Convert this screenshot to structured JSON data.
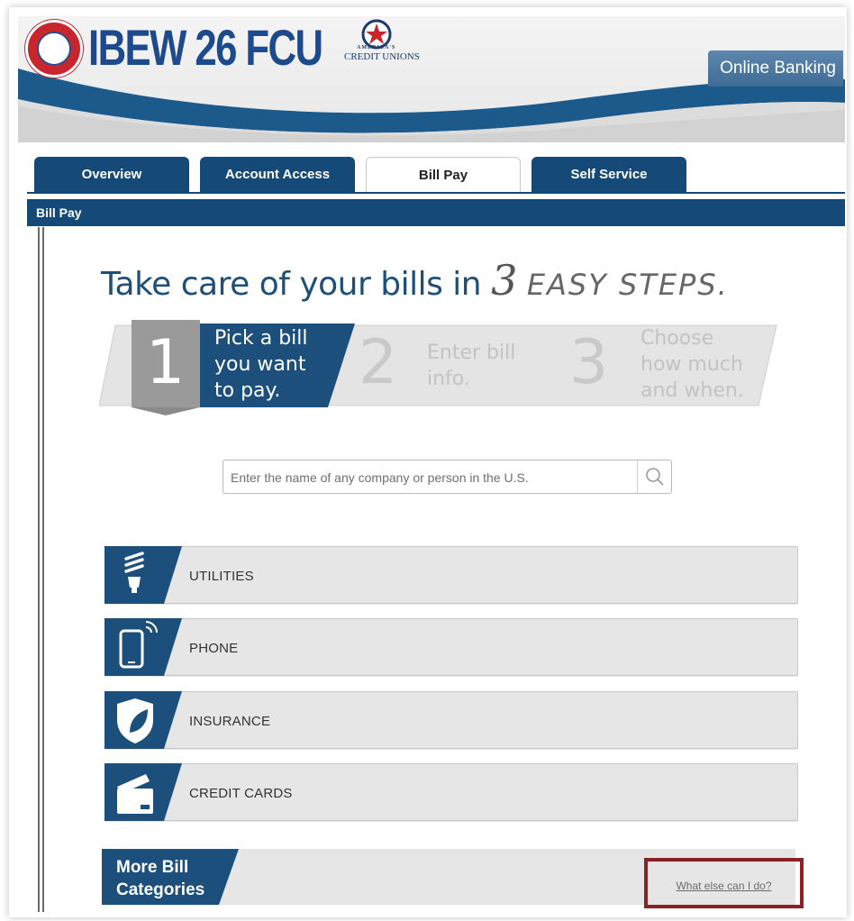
{
  "brand": {
    "name": "IBEW 26 FCU",
    "cu_top": "AMERICA'S",
    "cu_bottom": "CREDIT UNIONS",
    "online_banking_label": "Online Banking",
    "colors": {
      "navy": "#154a78",
      "brand_blue": "#1d4a8c",
      "seal_red": "#c8252c",
      "highlight_box": "#8b2027"
    }
  },
  "tabs": [
    {
      "label": "Overview",
      "active": false
    },
    {
      "label": "Account Access",
      "active": false
    },
    {
      "label": "Bill Pay",
      "active": true
    },
    {
      "label": "Self Service",
      "active": false
    }
  ],
  "section_title": "Bill Pay",
  "headline": {
    "text": "Take care of your bills in",
    "number": "3",
    "emphasis": "EASY STEPS."
  },
  "steps": [
    {
      "number": "1",
      "lines": [
        "Pick a bill",
        "you want",
        "to pay."
      ],
      "active": true
    },
    {
      "number": "2",
      "lines": [
        "Enter bill",
        "info."
      ],
      "active": false
    },
    {
      "number": "3",
      "lines": [
        "Choose",
        "how much",
        "and when."
      ],
      "active": false
    }
  ],
  "search": {
    "placeholder": "Enter the name of any company or person in the U.S.",
    "value": "",
    "icon": "search-icon"
  },
  "categories": [
    {
      "label": "UTILITIES",
      "icon": "light-bulb-icon"
    },
    {
      "label": "PHONE",
      "icon": "mobile-phone-icon"
    },
    {
      "label": "INSURANCE",
      "icon": "shield-leaf-icon"
    },
    {
      "label": "CREDIT CARDS",
      "icon": "credit-card-icon"
    }
  ],
  "more_categories": {
    "lines": [
      "More Bill",
      "Categories"
    ]
  },
  "what_else_link": "What else can I do?"
}
